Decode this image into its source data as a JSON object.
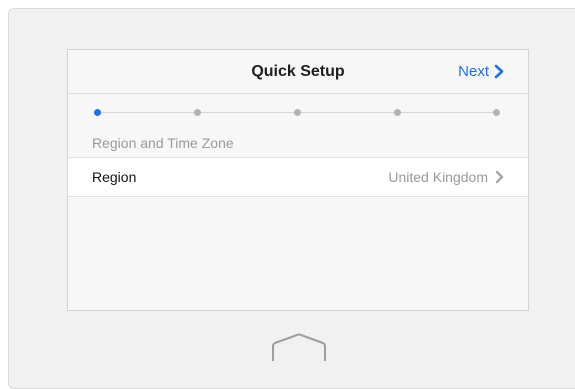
{
  "header": {
    "title": "Quick Setup",
    "next_label": "Next"
  },
  "steps": {
    "count": 5,
    "active_index": 0,
    "current_label": "Region and Time Zone"
  },
  "region_row": {
    "label": "Region",
    "value": "United Kingdom"
  },
  "icons": {
    "next": "chevron-right-icon",
    "row": "chevron-right-icon",
    "home": "home-icon"
  },
  "colors": {
    "accent": "#1a73e8",
    "inactive_dot": "#b3b3b3",
    "muted_text": "#9a9a9a"
  }
}
